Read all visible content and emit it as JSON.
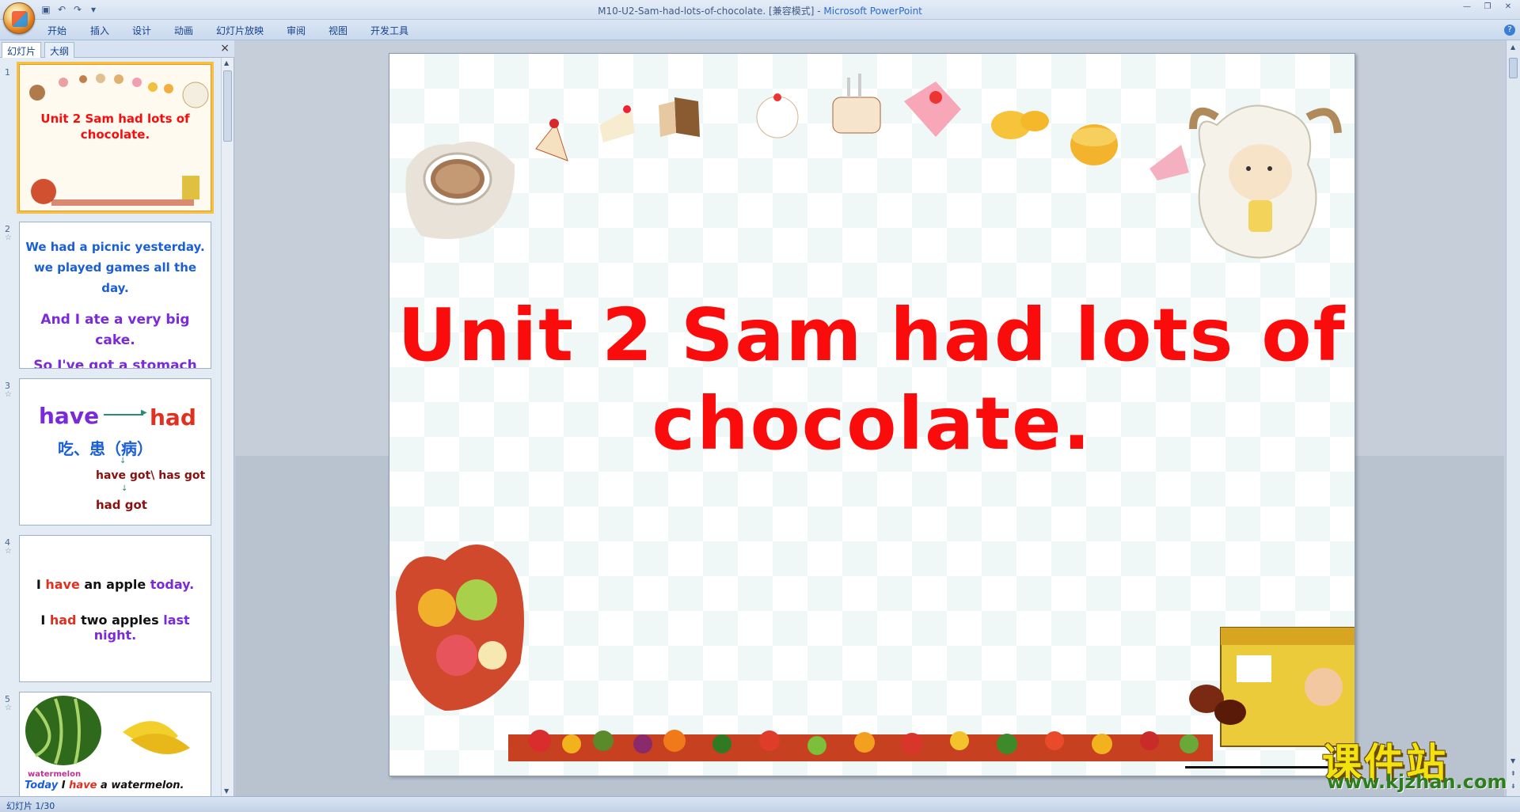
{
  "window": {
    "title": "M10-U2-Sam-had-lots-of-chocolate. [兼容模式]",
    "app_name": "Microsoft PowerPoint",
    "separator": " - "
  },
  "ribbon": {
    "tabs": [
      "开始",
      "插入",
      "设计",
      "动画",
      "幻灯片放映",
      "审阅",
      "视图",
      "开发工具"
    ]
  },
  "left_pane": {
    "tabs": [
      "幻灯片",
      "大纲"
    ],
    "close": "×"
  },
  "thumbnails": [
    {
      "num": "1",
      "lines": [
        "Unit 2 Sam had lots of",
        "chocolate."
      ]
    },
    {
      "num": "2",
      "lines": [
        "We had a picnic yesterday.",
        "we played games all the day.",
        "And I ate a very big cake.",
        "So I've got a stomach ache."
      ]
    },
    {
      "num": "3",
      "have": "have",
      "had": "had",
      "cn": "吃、患（病）",
      "havegot": "have got\\ has got",
      "hadgot": "had got"
    },
    {
      "num": "4",
      "line1": [
        "I ",
        "have",
        " an apple ",
        "today."
      ],
      "line2": [
        "I ",
        "had",
        " two apples ",
        "last night."
      ]
    },
    {
      "num": "5",
      "label": "watermelon",
      "sentence": [
        "Today",
        " I ",
        "have",
        " a watermelon."
      ]
    }
  ],
  "slide": {
    "title_line1": "Unit 2 Sam had lots of",
    "title_line2": "chocolate."
  },
  "status": {
    "slide_counter": "幻灯片 1/30"
  },
  "watermark": {
    "brand": "课件站",
    "url": "www.kjzhan.com"
  },
  "colors": {
    "title_red": "#fb0c0c",
    "thumb_selected": "#f5c04a",
    "thumb_blue": "#1b5fd6",
    "thumb_purple": "#7a2ad9",
    "thumb_red": "#e03020"
  }
}
